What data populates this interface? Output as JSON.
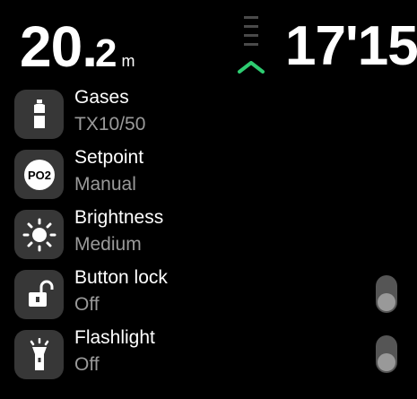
{
  "header": {
    "depth_integer": "20.",
    "depth_decimal": "2",
    "depth_unit": "m",
    "time": "17'15",
    "ascent_icon": "chevron-up-icon",
    "ascent_color": "#2ecc71"
  },
  "menu": {
    "items": [
      {
        "title": "Gases",
        "value": "TX10/50",
        "icon": "tank-icon"
      },
      {
        "title": "Setpoint",
        "value": "Manual",
        "icon": "po2-icon",
        "icon_text": "PO2"
      },
      {
        "title": "Brightness",
        "value": "Medium",
        "icon": "sun-icon"
      },
      {
        "title": "Button lock",
        "value": "Off",
        "icon": "unlock-icon",
        "toggle": "off"
      },
      {
        "title": "Flashlight",
        "value": "Off",
        "icon": "flashlight-icon",
        "toggle": "off"
      }
    ]
  },
  "colors": {
    "background": "#000000",
    "icon_tile": "#373737",
    "secondary_text": "#9a9a9a",
    "accent": "#2ecc71"
  }
}
